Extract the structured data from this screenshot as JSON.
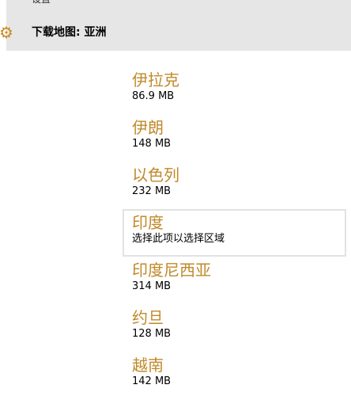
{
  "header": {
    "settings_label": "设置",
    "title": "下载地图: 亚洲",
    "gear_icon": "gear-icon"
  },
  "colors": {
    "accent": "#c0892a",
    "header_bg": "#e6e6e6",
    "selected_border": "#e2e2e2"
  },
  "regions": [
    {
      "name": "伊拉克",
      "size": "86.9 MB"
    },
    {
      "name": "伊朗",
      "size": "148 MB"
    },
    {
      "name": "以色列",
      "size": "232 MB"
    },
    {
      "name": "印度",
      "size": "选择此项以选择区域"
    },
    {
      "name": "印度尼西亚",
      "size": "314 MB"
    },
    {
      "name": "约旦",
      "size": "128 MB"
    },
    {
      "name": "越南",
      "size": "142 MB"
    }
  ]
}
